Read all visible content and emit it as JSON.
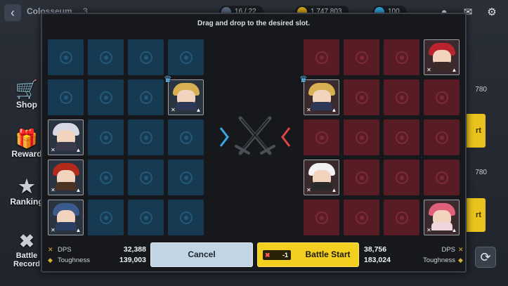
{
  "topbar": {
    "title": "Colosseum",
    "level": "3",
    "resource1": "16 / 22",
    "resource2": "1,747,803",
    "resource3": "100"
  },
  "background_nav": [
    {
      "label": "Shop",
      "icon": "cart-icon"
    },
    {
      "label": "Reward",
      "icon": "gift-icon"
    },
    {
      "label": "Ranking",
      "icon": "star-icon"
    },
    {
      "label": "Battle Record",
      "icon": "scroll-icon"
    }
  ],
  "background_right": {
    "power1": "780",
    "power2": "780",
    "btn1": "rt",
    "btn2": "rt"
  },
  "modal": {
    "instruction": "Drag and drop to the desired slot.",
    "ally": {
      "dps_label": "DPS",
      "dps_value": "32,388",
      "toughness_label": "Toughness",
      "toughness_value": "139,003",
      "heroes": [
        {
          "slot": [
            1,
            3
          ],
          "name": "captain-hero",
          "leader": true,
          "hair": "#d7b052",
          "body": "#2d3756"
        },
        {
          "slot": [
            2,
            0
          ],
          "name": "silver-hair-hero",
          "leader": false,
          "hair": "#d8d8e4",
          "body": "#3a3a4a"
        },
        {
          "slot": [
            3,
            0
          ],
          "name": "pirate-hero",
          "leader": false,
          "hair": "#b22a1c",
          "body": "#4a3322"
        },
        {
          "slot": [
            4,
            0
          ],
          "name": "blue-witch-hero",
          "leader": false,
          "hair": "#3c5a8c",
          "body": "#2b3d61"
        }
      ]
    },
    "enemy": {
      "dps_label": "DPS",
      "dps_value": "38,756",
      "toughness_label": "Toughness",
      "toughness_value": "183,024",
      "heroes": [
        {
          "slot": [
            0,
            3
          ],
          "name": "red-hood-hero",
          "leader": false,
          "hair": "#b8232e",
          "body": "#3a2a28"
        },
        {
          "slot": [
            1,
            0
          ],
          "name": "captain-hero",
          "leader": true,
          "hair": "#d7b052",
          "body": "#2d3756"
        },
        {
          "slot": [
            3,
            0
          ],
          "name": "panda-hero",
          "leader": false,
          "hair": "#f2f2f2",
          "body": "#2a2a2a"
        },
        {
          "slot": [
            4,
            3
          ],
          "name": "pink-hair-hero",
          "leader": false,
          "hair": "#e0607c",
          "body": "#f0d6dc"
        }
      ]
    },
    "cancel_label": "Cancel",
    "start_cost": "-1",
    "start_label": "Battle Start"
  },
  "colors": {
    "ally_slot": "#173a53",
    "enemy_slot": "#5a1c24",
    "start_button": "#f3cf1f",
    "cancel_button": "#c3d4e4",
    "ally_arrow": "#3aa6e8",
    "enemy_arrow": "#e04545"
  }
}
